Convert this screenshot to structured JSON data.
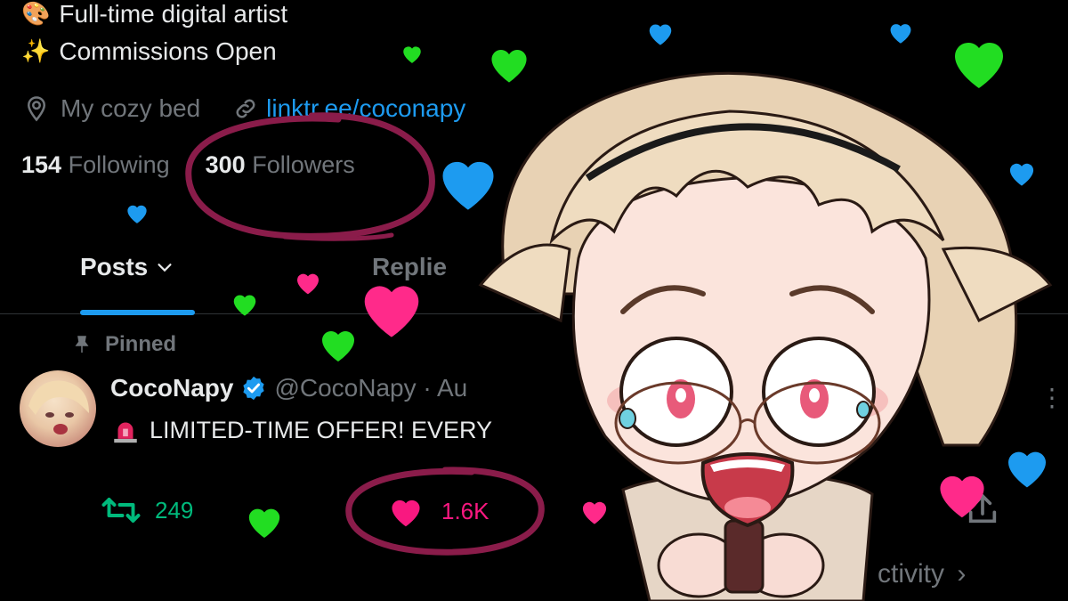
{
  "profile": {
    "bio_line1": "Full-time digital artist",
    "bio_line1_icon": "palette-emoji",
    "bio_line2": "Commissions Open",
    "bio_line2_icon": "sparkles-emoji",
    "location": "My cozy bed",
    "link": "linktr.ee/coconapy",
    "following_count": "154",
    "following_label": "Following",
    "followers_count": "300",
    "followers_label": "Followers"
  },
  "tabs": [
    {
      "label": "Posts"
    },
    {
      "label": "Replie"
    }
  ],
  "post": {
    "pinned_label": "Pinned",
    "author_name": "CocoNapy",
    "author_handle": "@CocoNapy · Au",
    "text": "LIMITED-TIME OFFER! EVERY",
    "retweets": "249",
    "likes": "1.6K",
    "activity_label": "ctivity"
  },
  "colors": {
    "accent_blue": "#1d9bf0",
    "retweet_green": "#00ba7c",
    "like_pink": "#f91880",
    "circle_marker": "#8a1c4a",
    "deco_green": "#22dd22",
    "deco_blue": "#1d9bf0",
    "deco_pink": "#ff2a8a"
  }
}
